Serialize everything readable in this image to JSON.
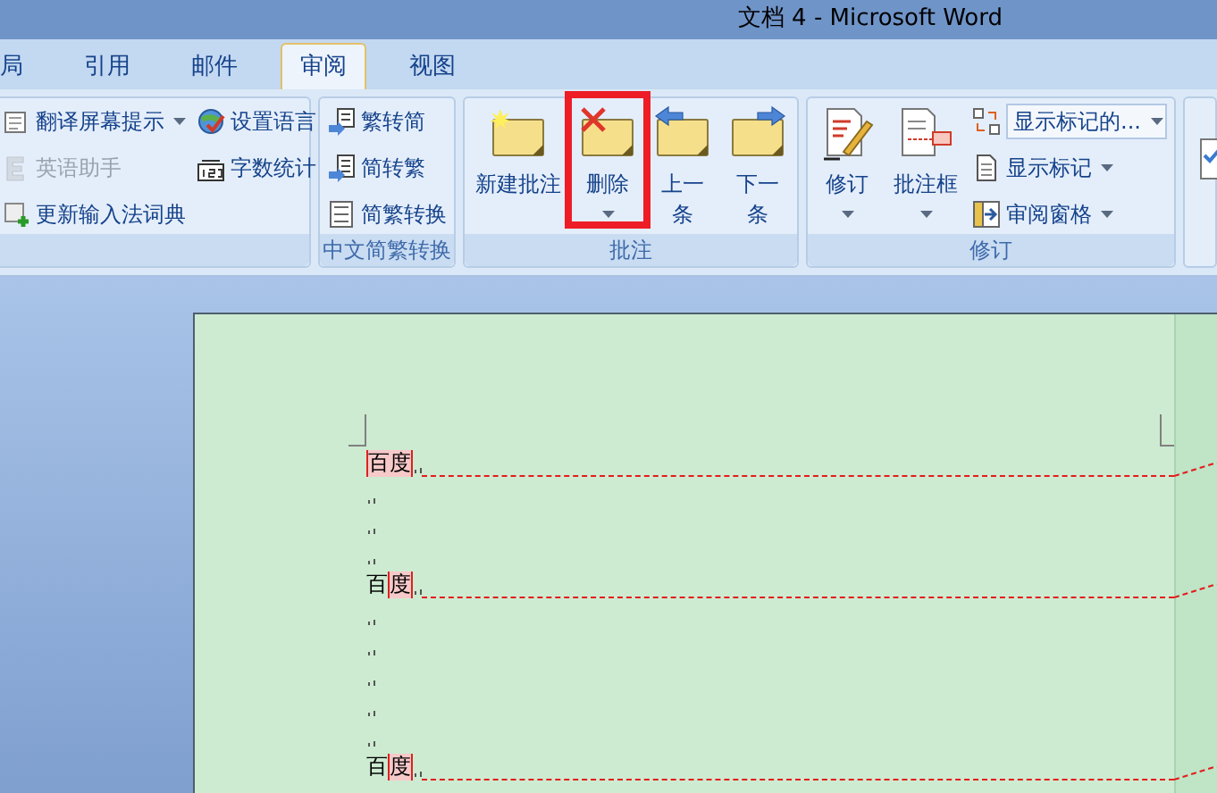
{
  "title_bar": {
    "title": "文档 4 - Microsoft Word"
  },
  "tabs": [
    {
      "label": "局",
      "selected": false
    },
    {
      "label": "引用",
      "selected": false
    },
    {
      "label": "邮件",
      "selected": false
    },
    {
      "label": "审阅",
      "selected": true
    },
    {
      "label": "视图",
      "selected": false
    }
  ],
  "ribbon": {
    "groups": [
      {
        "columns": [
          [
            {
              "kind": "small",
              "label": "翻译屏幕提示",
              "dropdown": true,
              "disabled": false
            },
            {
              "kind": "small",
              "label": "英语助手",
              "dropdown": false,
              "disabled": true
            },
            {
              "kind": "small",
              "label": "更新输入法词典",
              "dropdown": false,
              "disabled": false
            }
          ],
          [
            {
              "kind": "small",
              "label": "设置语言",
              "dropdown": false,
              "disabled": false
            },
            {
              "kind": "small",
              "label": "字数统计",
              "dropdown": false,
              "disabled": false
            }
          ]
        ]
      },
      {
        "label": "中文简繁转换",
        "columns": [
          [
            {
              "kind": "small",
              "label": "繁转简",
              "dropdown": false,
              "disabled": false
            },
            {
              "kind": "small",
              "label": "简转繁",
              "dropdown": false,
              "disabled": false
            },
            {
              "kind": "small",
              "label": "简繁转换",
              "dropdown": false,
              "disabled": false
            }
          ]
        ]
      },
      {
        "label": "批注",
        "columns": [
          [
            {
              "kind": "large",
              "label": "新建批注",
              "dropdown": false,
              "highlighted": false
            }
          ],
          [
            {
              "kind": "large",
              "label": "删除",
              "dropdown": true,
              "highlighted": true
            }
          ],
          [
            {
              "kind": "large",
              "label": "上一条",
              "dropdown": false,
              "highlighted": false
            }
          ],
          [
            {
              "kind": "large",
              "label": "下一条",
              "dropdown": false,
              "highlighted": false
            }
          ]
        ]
      },
      {
        "label": "修订",
        "columns": [
          [
            {
              "kind": "large",
              "label": "修订",
              "dropdown": true,
              "highlighted": false
            }
          ],
          [
            {
              "kind": "large",
              "label": "批注框",
              "dropdown": true,
              "highlighted": false
            }
          ],
          [
            {
              "kind": "select",
              "value": "显示标记的..."
            },
            {
              "kind": "small",
              "label": "显示标记",
              "dropdown": true,
              "disabled": false
            },
            {
              "kind": "small",
              "label": "审阅窗格",
              "dropdown": true,
              "disabled": false
            }
          ]
        ]
      }
    ]
  },
  "document": {
    "paragraphs": [
      {
        "kind": "comment",
        "commented": "百度"
      },
      {
        "kind": "empty"
      },
      {
        "kind": "empty"
      },
      {
        "kind": "empty"
      },
      {
        "kind": "comment",
        "before": "百",
        "commented": "度"
      },
      {
        "kind": "empty"
      },
      {
        "kind": "empty"
      },
      {
        "kind": "empty"
      },
      {
        "kind": "empty"
      },
      {
        "kind": "empty"
      },
      {
        "kind": "comment",
        "before": "百",
        "commented": "度"
      }
    ]
  }
}
